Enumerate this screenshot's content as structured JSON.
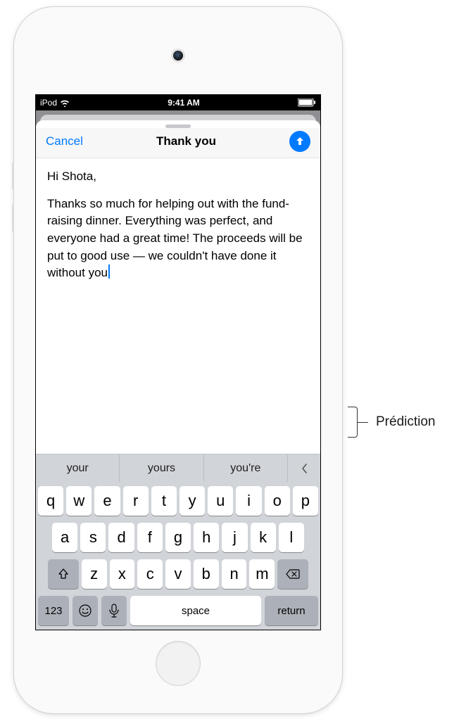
{
  "status": {
    "carrier": "iPod",
    "time": "9:41 AM"
  },
  "compose": {
    "cancel": "Cancel",
    "title": "Thank you",
    "greeting": "Hi Shota,",
    "body": "Thanks so much for helping out with the fund-raising dinner. Everything was perfect, and everyone had a great time! The proceeds will be put to good use — we couldn't have done it without you"
  },
  "predictions": [
    "your",
    "yours",
    "you're"
  ],
  "keyboard": {
    "row1": [
      "q",
      "w",
      "e",
      "r",
      "t",
      "y",
      "u",
      "i",
      "o",
      "p"
    ],
    "row2": [
      "a",
      "s",
      "d",
      "f",
      "g",
      "h",
      "j",
      "k",
      "l"
    ],
    "row3": [
      "z",
      "x",
      "c",
      "v",
      "b",
      "n",
      "m"
    ],
    "numkey": "123",
    "space": "space",
    "return": "return"
  },
  "annotation": {
    "label": "Prédiction"
  }
}
